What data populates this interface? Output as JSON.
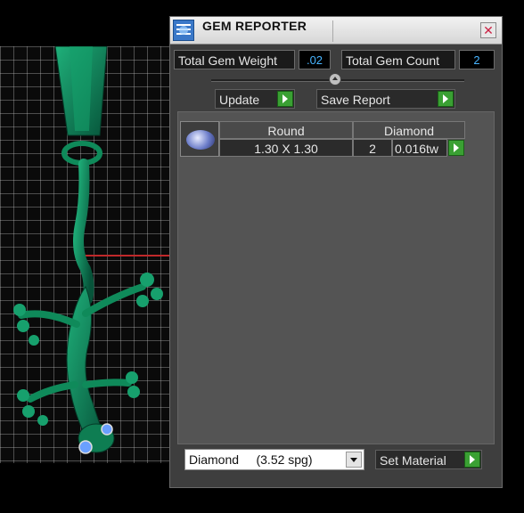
{
  "dialog": {
    "title": "GEM REPORTER",
    "close_label": "✕",
    "total_weight_label": "Total Gem Weight",
    "total_weight_value": ".02",
    "total_count_label": "Total Gem Count",
    "total_count_value": "2",
    "update_label": "Update",
    "save_report_label": "Save Report"
  },
  "report": {
    "gems": [
      {
        "shape": "Round",
        "material": "Diamond",
        "size": "1.30 X 1.30",
        "count": "2",
        "weight": "0.016tw"
      }
    ]
  },
  "material_select": {
    "value": "Diamond     (3.52 spg)",
    "set_label": "Set Material"
  },
  "colors": {
    "accent_value": "#47b4ff",
    "go_button": "#3aa033",
    "model": "#0f8a5a",
    "axis": "#c0282a"
  },
  "icons": [
    "app-icon",
    "close-icon",
    "slider-knob-icon",
    "play-icon",
    "gem-icon",
    "chevron-down-icon"
  ]
}
